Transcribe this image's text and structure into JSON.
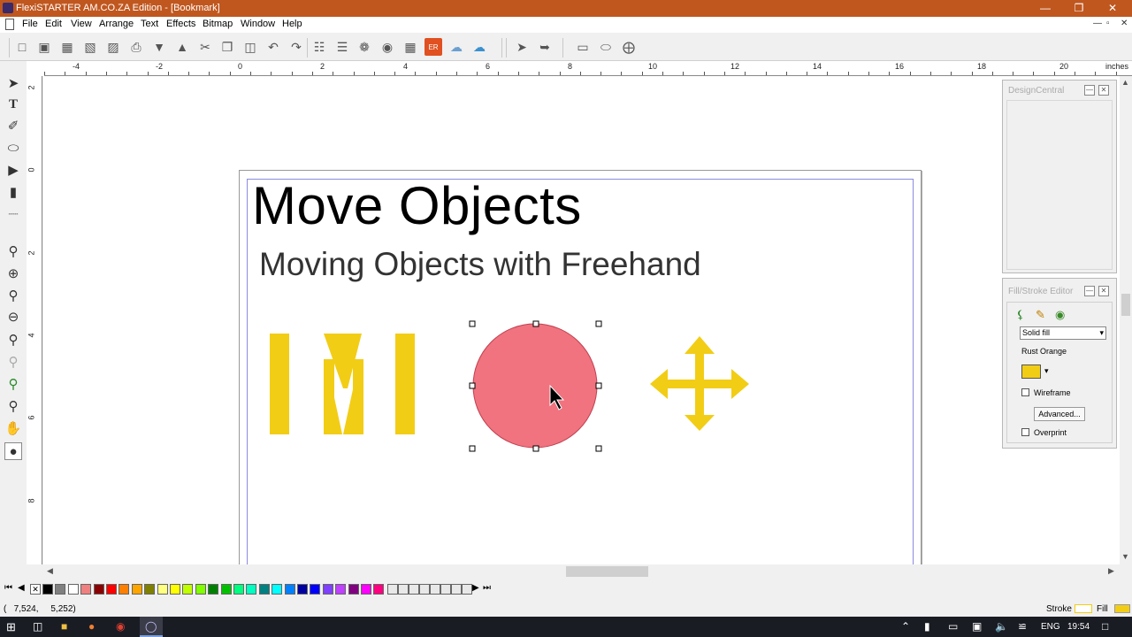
{
  "window": {
    "title": "FlexiSTARTER AM.CO.ZA Edition - [Bookmark]",
    "min": "—",
    "max": "❐",
    "close": "✕"
  },
  "menu": [
    "File",
    "Edit",
    "View",
    "Arrange",
    "Text",
    "Effects",
    "Bitmap",
    "Window",
    "Help"
  ],
  "mdi": {
    "min": "—",
    "restore": "▫",
    "close": "✕"
  },
  "ruler": {
    "h_labels": [
      "-4",
      "-2",
      "0",
      "2",
      "4",
      "6",
      "8",
      "10",
      "12",
      "14",
      "16",
      "18",
      "20"
    ],
    "unit": "inches",
    "v_labels": [
      "2",
      "0",
      "2",
      "4",
      "6",
      "8"
    ]
  },
  "canvas": {
    "title": "Move Objects",
    "subtitle": "Moving Objects with Freehand"
  },
  "panels": {
    "design_central": {
      "title": "DesignCentral"
    },
    "fill_stroke": {
      "title": "Fill/Stroke Editor",
      "fill_type": "Solid fill",
      "color_name": "Rust Orange",
      "wireframe": "Wireframe",
      "advanced": "Advanced...",
      "overprint": "Overprint"
    }
  },
  "colors": {
    "yellow": "#f2cd15",
    "circle": "#f0737f",
    "title_bar": "#c0571f"
  },
  "palette": [
    "#000000",
    "#808080",
    "#ffffff",
    "#f08080",
    "#8b0000",
    "#ff0000",
    "#ff8000",
    "#ffa500",
    "#808000",
    "#ffff80",
    "#ffff00",
    "#c0ff00",
    "#80ff00",
    "#008000",
    "#00c000",
    "#00ff80",
    "#00ffc0",
    "#008080",
    "#00ffff",
    "#0080ff",
    "#0000a0",
    "#0000ff",
    "#8040ff",
    "#c040ff",
    "#800080",
    "#ff00ff",
    "#ff0080"
  ],
  "status": {
    "coords": "(   7,524,     5,252)",
    "stroke": "Stroke",
    "fill": "Fill"
  },
  "taskbar": {
    "lang": "ENG",
    "time": "19:54"
  }
}
